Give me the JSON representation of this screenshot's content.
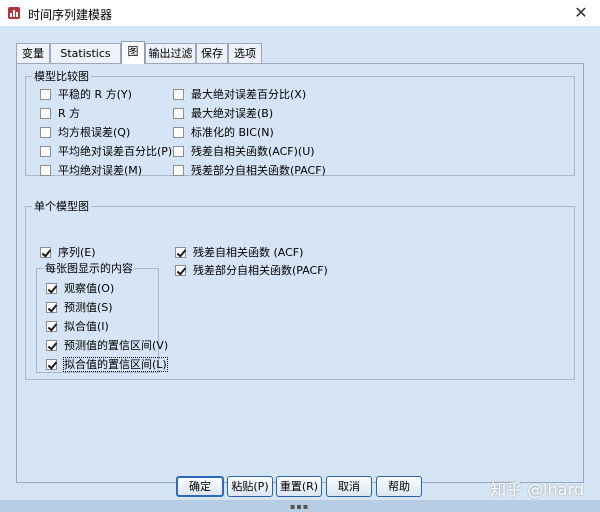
{
  "window": {
    "title": "时间序列建模器",
    "close_label": "✕"
  },
  "tabs": [
    {
      "label": "变量"
    },
    {
      "label": "Statistics"
    },
    {
      "label": "图",
      "active": true
    },
    {
      "label": "输出过滤"
    },
    {
      "label": "保存"
    },
    {
      "label": "选项"
    }
  ],
  "model_compare": {
    "legend": "模型比较图",
    "items": [
      {
        "label": "平稳的 R 方(Y)",
        "checked": false
      },
      {
        "label": "R 方",
        "checked": false
      },
      {
        "label": "均方根误差(Q)",
        "checked": false
      },
      {
        "label": "平均绝对误差百分比(P)",
        "checked": false
      },
      {
        "label": "平均绝对误差(M)",
        "checked": false
      },
      {
        "label": "最大绝对误差百分比(X)",
        "checked": false
      },
      {
        "label": "最大绝对误差(B)",
        "checked": false
      },
      {
        "label": "标准化的 BIC(N)",
        "checked": false
      },
      {
        "label": "残差自相关函数(ACF)(U)",
        "checked": false
      },
      {
        "label": "残差部分自相关函数(PACF)",
        "checked": false
      }
    ]
  },
  "single_model": {
    "legend": "单个模型图",
    "series": {
      "label": "序列(E)",
      "checked": true
    },
    "residual_acf": {
      "label": "残差自相关函数 (ACF)",
      "checked": true
    },
    "residual_pacf": {
      "label": "残差部分自相关函数(PACF)",
      "checked": true
    },
    "contents": {
      "legend": "每张图显示的内容",
      "items": [
        {
          "label": "观察值(O)",
          "checked": true
        },
        {
          "label": "预测值(S)",
          "checked": true
        },
        {
          "label": "拟合值(I)",
          "checked": true
        },
        {
          "label": "预测值的置信区间(V)",
          "checked": true
        },
        {
          "label": "拟合值的置信区间(L)",
          "checked": true
        }
      ]
    }
  },
  "buttons": {
    "ok": "确定",
    "paste": "粘贴(P)",
    "reset": "重置(R)",
    "cancel": "取消",
    "help": "帮助"
  },
  "watermark": "知乎 @lhard",
  "icons": {
    "app": "spss-app-icon",
    "close": "close-icon"
  },
  "colors": {
    "client_bg": "#d6e5f5",
    "button_border": "#2d62a8"
  }
}
